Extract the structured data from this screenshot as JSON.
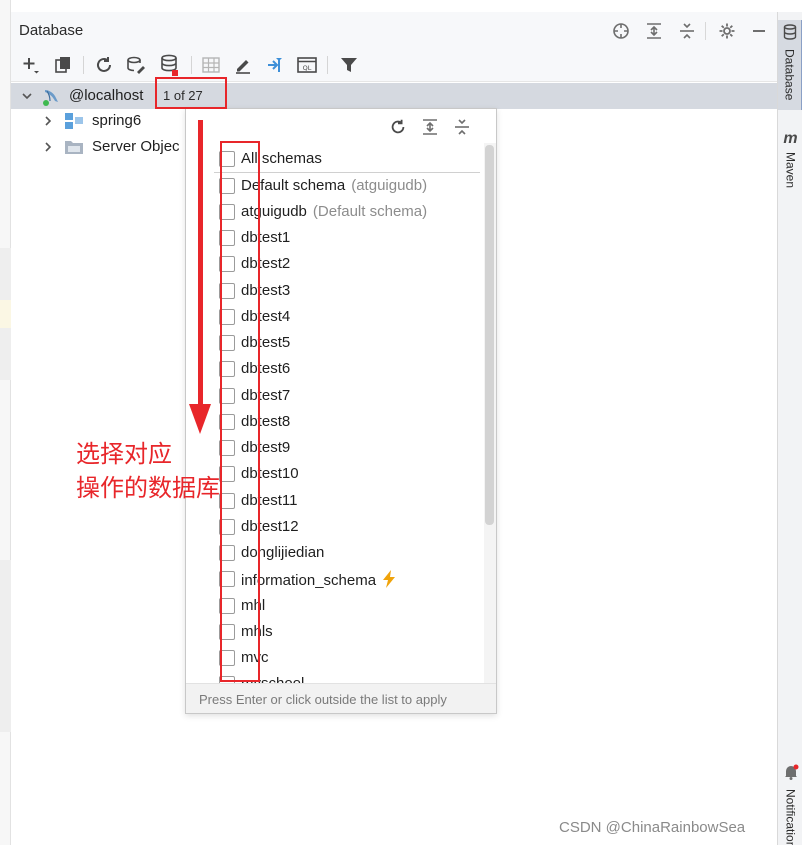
{
  "panel": {
    "title": "Database"
  },
  "tree": {
    "root": {
      "label": "@localhost",
      "count": "1 of 27"
    },
    "children": [
      {
        "label": "spring6"
      },
      {
        "label": "Server Objec"
      }
    ]
  },
  "schema_popup": {
    "items": [
      {
        "label": "All schemas"
      },
      {
        "label": "Default schema",
        "hint": "(atguigudb)"
      },
      {
        "label": "atguigudb",
        "hint": "(Default schema)"
      },
      {
        "label": "dbtest1"
      },
      {
        "label": "dbtest2"
      },
      {
        "label": "dbtest3"
      },
      {
        "label": "dbtest4"
      },
      {
        "label": "dbtest5"
      },
      {
        "label": "dbtest6"
      },
      {
        "label": "dbtest7"
      },
      {
        "label": "dbtest8"
      },
      {
        "label": "dbtest9"
      },
      {
        "label": "dbtest10"
      },
      {
        "label": "dbtest11"
      },
      {
        "label": "dbtest12"
      },
      {
        "label": "donglijiedian"
      },
      {
        "label": "information_schema"
      },
      {
        "label": "mhl"
      },
      {
        "label": "mhls"
      },
      {
        "label": "mvc"
      },
      {
        "label": "myschool"
      }
    ],
    "footer": "Press Enter or click outside the list to apply"
  },
  "right_stripe": {
    "database_tab": "Database",
    "maven_tab": "Maven",
    "notifications_tab": "Notifications"
  },
  "annotation": {
    "line1": "选择对应",
    "line2": "操作的数据库"
  },
  "watermark": "CSDN @ChinaRainbowSea",
  "colors": {
    "annotation_red": "#e8262a",
    "selection_bg": "#d5d9e0",
    "accent_blue": "#3d8fd8"
  }
}
